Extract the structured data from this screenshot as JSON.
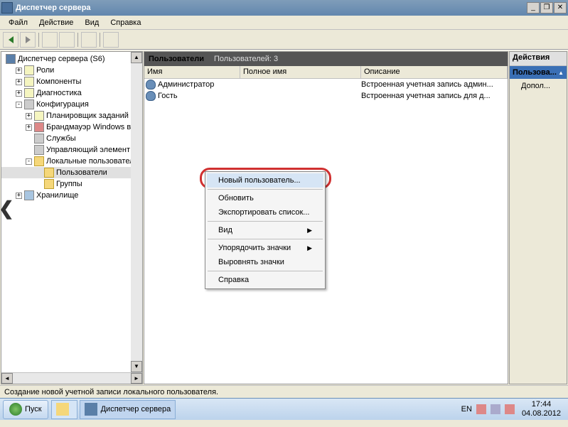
{
  "window": {
    "title": "Диспетчер сервера"
  },
  "menu": {
    "file": "Файл",
    "action": "Действие",
    "view": "Вид",
    "help": "Справка"
  },
  "tree": {
    "root": "Диспетчер сервера (S6)",
    "roles": "Роли",
    "components": "Компоненты",
    "diagnostics": "Диагностика",
    "config": "Конфигурация",
    "scheduler": "Планировщик заданий",
    "firewall": "Брандмауэр Windows в ре",
    "services": "Службы",
    "wmi": "Управляющий элемент W",
    "localusers": "Локальные пользователи",
    "users": "Пользователи",
    "groups": "Группы",
    "storage": "Хранилище"
  },
  "content": {
    "header": "Пользователи",
    "count": "Пользователей: 3",
    "col_name": "Имя",
    "col_fullname": "Полное имя",
    "col_desc": "Описание",
    "rows": [
      {
        "name": "Администратор",
        "full": "",
        "desc": "Встроенная учетная запись админ..."
      },
      {
        "name": "Гость",
        "full": "",
        "desc": "Встроенная учетная запись для д..."
      }
    ]
  },
  "context": {
    "newuser": "Новый пользователь...",
    "refresh": "Обновить",
    "export": "Экспортировать список...",
    "view": "Вид",
    "arrange": "Упорядочить значки",
    "align": "Выровнять значки",
    "help": "Справка"
  },
  "actions": {
    "title": "Действия",
    "section": "Пользова...",
    "more": "Допол..."
  },
  "status": "Создание новой учетной записи локального пользователя.",
  "taskbar": {
    "start": "Пуск",
    "app": "Диспетчер сервера",
    "lang": "EN",
    "time": "17:44",
    "date": "04.08.2012"
  }
}
